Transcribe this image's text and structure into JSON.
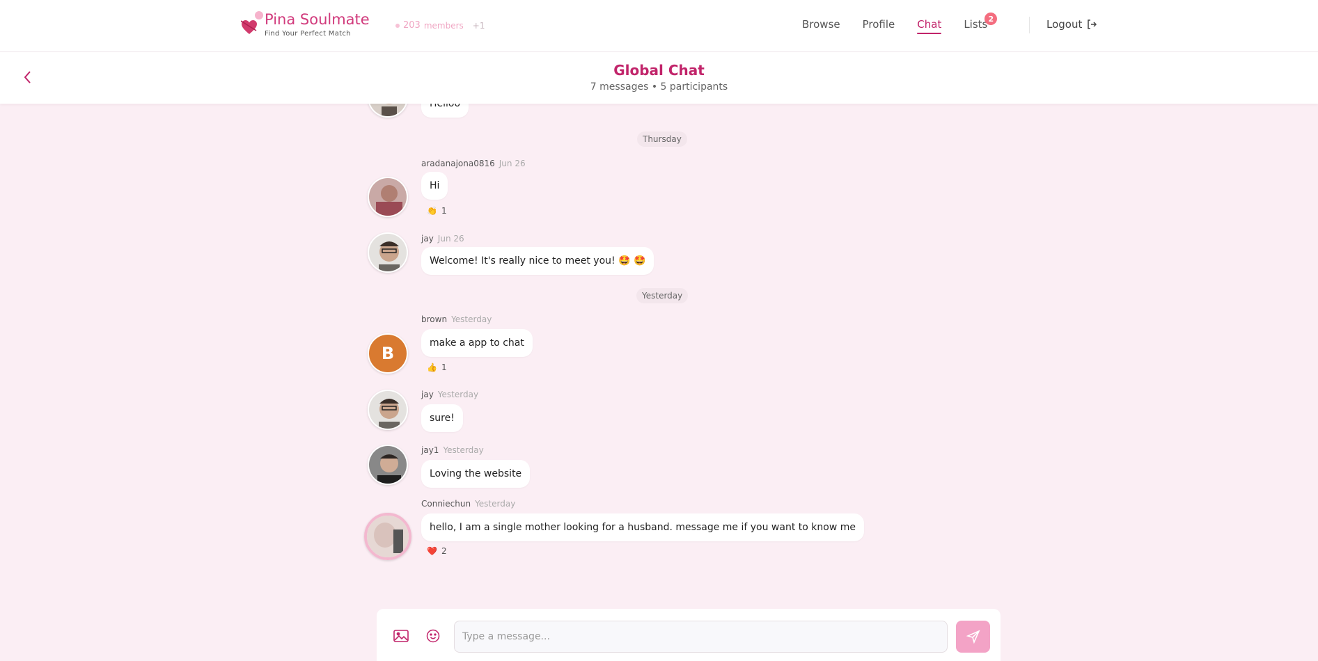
{
  "app": {
    "name": "Pina Soulmate",
    "tagline": "Find Your Perfect Match",
    "members_count": "203",
    "members_label": "members",
    "members_plus": "+1"
  },
  "nav": {
    "links": [
      {
        "label": "Browse"
      },
      {
        "label": "Profile"
      },
      {
        "label": "Chat"
      },
      {
        "label": "Lists",
        "badge": "2"
      }
    ],
    "logout": "Logout"
  },
  "chat": {
    "title": "Global Chat",
    "subtitle": "7 messages • 5 participants"
  },
  "day_separators": [
    "Thursday",
    "Yesterday"
  ],
  "messages": [
    {
      "text": "Helloo"
    },
    {
      "user": "aradanajona0816",
      "time": "Jun 26",
      "text": "Hi",
      "reaction_emoji": "👏",
      "reaction_count": "1"
    },
    {
      "user": "jay",
      "time": "Jun 26",
      "text": "Welcome! It's really nice to meet you! 🤩 🤩"
    },
    {
      "user": "brown",
      "time": "Yesterday",
      "avatar_letter": "B",
      "text": "make a app to chat",
      "reaction_emoji": "👍",
      "reaction_count": "1"
    },
    {
      "user": "jay",
      "time": "Yesterday",
      "text": "sure!"
    },
    {
      "user": "jay1",
      "time": "Yesterday",
      "text": "Loving the website"
    },
    {
      "user": "Conniechun",
      "time": "Yesterday",
      "text": "hello, I am a single mother looking for a husband. message me if you want to know me",
      "reaction_emoji": "❤️",
      "reaction_count": "2"
    }
  ],
  "composer": {
    "placeholder": "Type a message..."
  },
  "colors": {
    "accent": "#c1246a",
    "background": "#fbeef4",
    "send_button": "#f3a3c6"
  }
}
